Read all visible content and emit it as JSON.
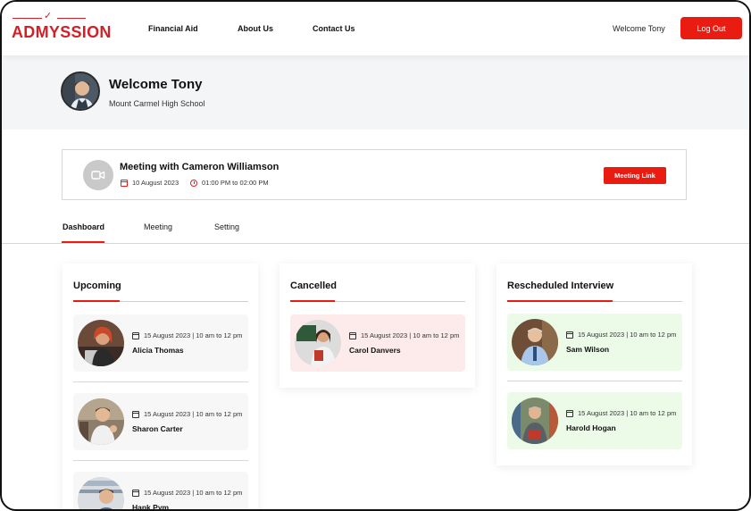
{
  "logo": {
    "text": "ADMYSSION",
    "check": "✓"
  },
  "nav": {
    "items": [
      "Financial Aid",
      "About Us",
      "Contact Us"
    ]
  },
  "header": {
    "welcome": "Welcome Tony",
    "logout_label": "Log Out"
  },
  "hero": {
    "title": "Welcome Tony",
    "school": "Mount Carmel High School"
  },
  "meeting": {
    "title": "Meeting with Cameron Williamson",
    "date": "10 August 2023",
    "time": "01:00 PM to 02:00 PM",
    "button_label": "Meeting Link"
  },
  "tabs": [
    "Dashboard",
    "Meeting",
    "Setting"
  ],
  "columns": {
    "upcoming": {
      "title": "Upcoming",
      "items": [
        {
          "date": "15 August 2023 | 10 am to 12 pm",
          "name": "Alicia Thomas"
        },
        {
          "date": "15 August 2023 | 10 am to 12 pm",
          "name": "Sharon Carter"
        },
        {
          "date": "15 August 2023 | 10 am to 12 pm",
          "name": "Hank Pym"
        }
      ]
    },
    "cancelled": {
      "title": "Cancelled",
      "items": [
        {
          "date": "15 August 2023 | 10 am to 12 pm",
          "name": "Carol Danvers"
        }
      ]
    },
    "rescheduled": {
      "title": "Rescheduled Interview",
      "items": [
        {
          "date": "15 August 2023 | 10 am to 12 pm",
          "name": "Sam Wilson"
        },
        {
          "date": "15 August 2023 | 10 am to 12 pm",
          "name": "Harold Hogan"
        }
      ]
    }
  },
  "colors": {
    "accent": "#ea1c12",
    "brand": "#d32027",
    "cancelled_bg": "#fdeaea",
    "rescheduled_bg": "#ebfbe8",
    "upcoming_bg": "#f7f7f7"
  }
}
